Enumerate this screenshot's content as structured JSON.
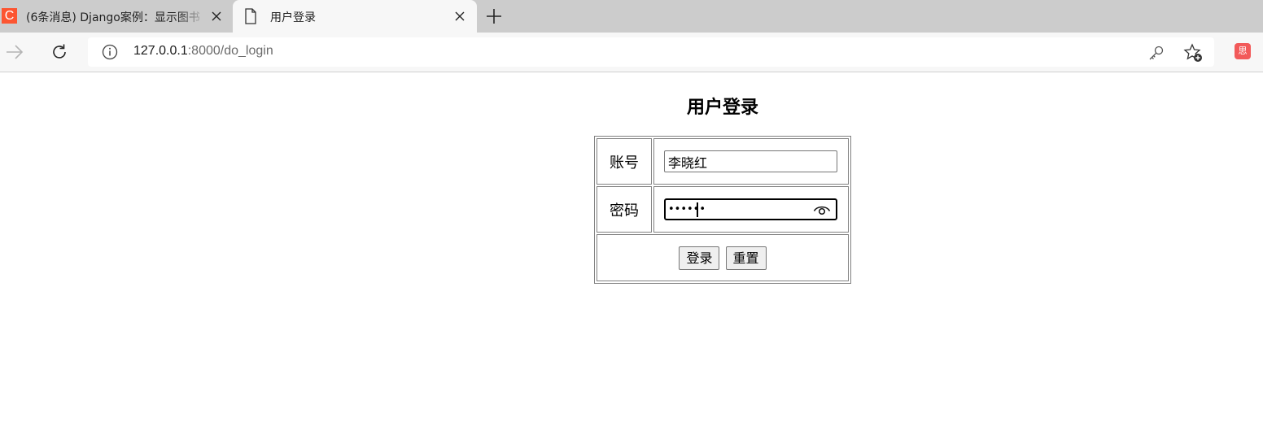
{
  "browser": {
    "tabs": [
      {
        "title": "(6条消息) Django案例：显示图书",
        "favicon": "C",
        "favicon_color": "#fc5531",
        "active": false
      },
      {
        "title": "用户登录",
        "active": true
      }
    ],
    "address_bar": {
      "host": "127.0.0.1",
      "rest": ":8000/do_login"
    },
    "extension_icon_label": "思",
    "icons": [
      "close-icon",
      "page-icon",
      "plus-icon",
      "forward-arrow-icon",
      "reload-icon",
      "info-icon",
      "key-icon",
      "star-add-icon"
    ]
  },
  "page": {
    "title": "用户登录",
    "form": {
      "username_label": "账号",
      "username_value": "李晓红",
      "password_label": "密码",
      "password_masked": "••••••",
      "login_button": "登录",
      "reset_button": "重置"
    }
  }
}
